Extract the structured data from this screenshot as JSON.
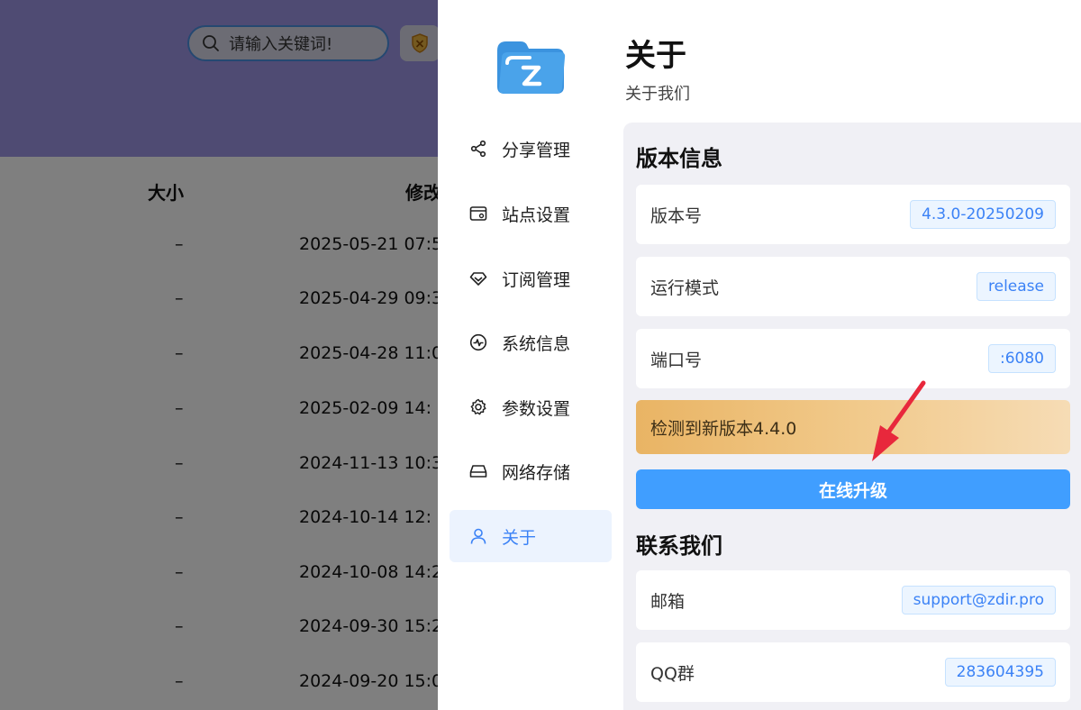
{
  "background": {
    "search_placeholder": "请输入关键词!",
    "columns": {
      "size": "大小",
      "modified": "修改"
    },
    "rows": [
      {
        "size": "–",
        "date": "2025-05-21 07:5"
      },
      {
        "size": "–",
        "date": "2025-04-29 09:3"
      },
      {
        "size": "–",
        "date": "2025-04-28 11:0"
      },
      {
        "size": "–",
        "date": "2025-02-09 14:"
      },
      {
        "size": "–",
        "date": "2024-11-13 10:3"
      },
      {
        "size": "–",
        "date": "2024-10-14 12:"
      },
      {
        "size": "–",
        "date": "2024-10-08 14:2"
      },
      {
        "size": "–",
        "date": "2024-09-30 15:2"
      },
      {
        "size": "–",
        "date": "2024-09-20 15:0"
      }
    ]
  },
  "nav": {
    "items": [
      {
        "label": "分享管理",
        "icon": "share-icon"
      },
      {
        "label": "站点设置",
        "icon": "site-settings-icon"
      },
      {
        "label": "订阅管理",
        "icon": "diamond-icon"
      },
      {
        "label": "系统信息",
        "icon": "activity-icon"
      },
      {
        "label": "参数设置",
        "icon": "gear-icon"
      },
      {
        "label": "网络存储",
        "icon": "drive-icon"
      },
      {
        "label": "关于",
        "icon": "user-icon",
        "active": true
      }
    ]
  },
  "page": {
    "title": "关于",
    "subtitle": "关于我们"
  },
  "version_info": {
    "title": "版本信息",
    "rows": [
      {
        "label": "版本号",
        "value": "4.3.0-20250209"
      },
      {
        "label": "运行模式",
        "value": "release"
      },
      {
        "label": "端口号",
        "value": ":6080"
      }
    ],
    "update_notice": "检测到新版本4.4.0",
    "upgrade_button": "在线升级"
  },
  "contact": {
    "title": "联系我们",
    "rows": [
      {
        "label": "邮箱",
        "value": "support@zdir.pro"
      },
      {
        "label": "QQ群",
        "value": "283604395"
      }
    ]
  },
  "colors": {
    "accent": "#409eff",
    "header_purple": "#9f97e6",
    "notice_orange": "#e9b464",
    "arrow_red": "#e8283c"
  }
}
